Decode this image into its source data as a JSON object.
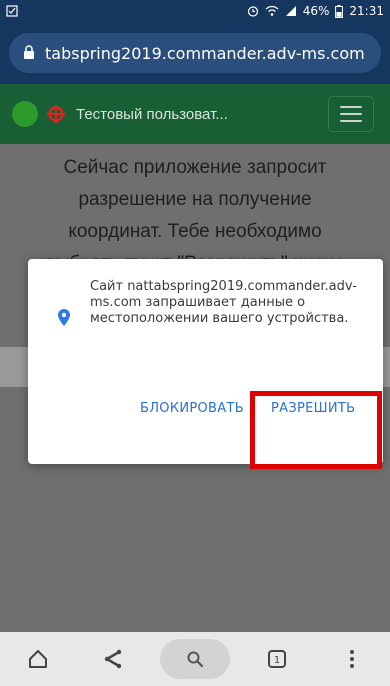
{
  "status_bar": {
    "battery": "46%",
    "time": "21:31"
  },
  "browser": {
    "url": "tabspring2019.commander.adv-ms.com"
  },
  "app_header": {
    "title": "Тестовый пользоват..."
  },
  "page": {
    "instructions": "Сейчас приложение запросит разрешение на получение координат. Тебе необходимо выбрать пункт \"Разрешить\" иначе"
  },
  "permission_dialog": {
    "message": "Сайт nattabspring2019.commander.adv-ms.com запрашивает данные о местоположении вашего устройства.",
    "block_label": "БЛОКИРОВАТЬ",
    "allow_label": "РАЗРЕШИТЬ"
  },
  "colors": {
    "status_bar": "#15365f",
    "app_header": "#195f35",
    "dialog_button": "#2a6fcc",
    "highlight": "#e00000"
  },
  "icons": {
    "checkbox": "checkbox-icon",
    "lock": "lock-icon",
    "crosshair": "crosshair-icon",
    "location_pin": "location-pin-icon",
    "nav": [
      "home-icon",
      "share-icon",
      "search-icon",
      "tabs-icon",
      "more-icon"
    ]
  },
  "nav_bar": {
    "tab_count": "1"
  }
}
